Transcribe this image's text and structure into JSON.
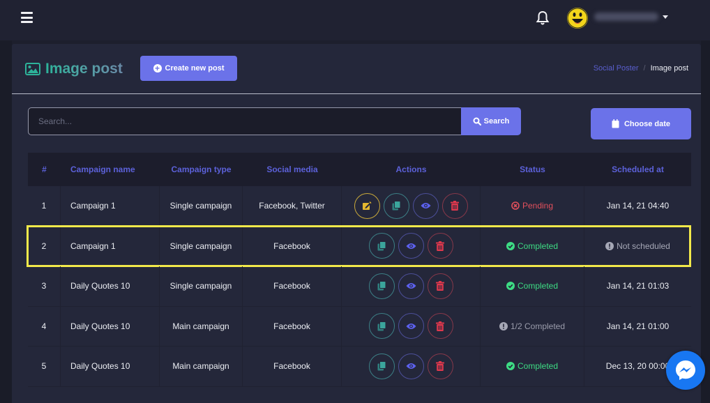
{
  "topbar": {
    "menu_icon": "hamburger-icon",
    "notification_icon": "bell-icon",
    "avatar_icon": "smiley-avatar",
    "username": "(blurred)",
    "dropdown_icon": "caret-down-icon"
  },
  "header": {
    "title": "Image post",
    "title_icon": "image-icon",
    "create_button": "Create new post",
    "breadcrumb": [
      "Social Poster",
      "Image post"
    ],
    "breadcrumb_separator": "/"
  },
  "search": {
    "placeholder": "Search...",
    "value": "",
    "button": "Search",
    "date_button": "Choose date"
  },
  "table": {
    "columns": [
      "#",
      "Campaign name",
      "Campaign type",
      "Social media",
      "Actions",
      "Status",
      "Scheduled at"
    ],
    "rows": [
      {
        "num": "1",
        "name": "Campaign 1",
        "type": "Single campaign",
        "social": "Facebook, Twitter",
        "actions": [
          "edit",
          "copy",
          "view",
          "delete"
        ],
        "status": "Pending",
        "status_kind": "pending",
        "scheduled": "Jan 14, 21 04:40"
      },
      {
        "num": "2",
        "name": "Campaign 1",
        "type": "Single campaign",
        "social": "Facebook",
        "actions": [
          "copy",
          "view",
          "delete"
        ],
        "status": "Completed",
        "status_kind": "completed",
        "scheduled": "Not scheduled",
        "highlighted": true
      },
      {
        "num": "3",
        "name": "Daily Quotes 10",
        "type": "Single campaign",
        "social": "Facebook",
        "actions": [
          "copy",
          "view",
          "delete"
        ],
        "status": "Completed",
        "status_kind": "completed",
        "scheduled": "Jan 14, 21 01:03"
      },
      {
        "num": "4",
        "name": "Daily Quotes 10",
        "type": "Main campaign",
        "social": "Facebook",
        "actions": [
          "copy",
          "view",
          "delete"
        ],
        "status": "1/2 Completed",
        "status_kind": "partial",
        "scheduled": "Jan 14, 21 01:00"
      },
      {
        "num": "5",
        "name": "Daily Quotes 10",
        "type": "Main campaign",
        "social": "Facebook",
        "actions": [
          "copy",
          "view",
          "delete"
        ],
        "status": "Completed",
        "status_kind": "completed",
        "scheduled": "Dec 13, 20 00:00"
      }
    ]
  },
  "colors": {
    "accent": "#6b72e9",
    "header_text": "#5c61d9",
    "pending": "#e2505c",
    "completed": "#3ddc84",
    "highlight": "#f2e94a",
    "messenger": "#1877f2"
  },
  "widgets": {
    "chat_icon": "messenger-icon"
  }
}
